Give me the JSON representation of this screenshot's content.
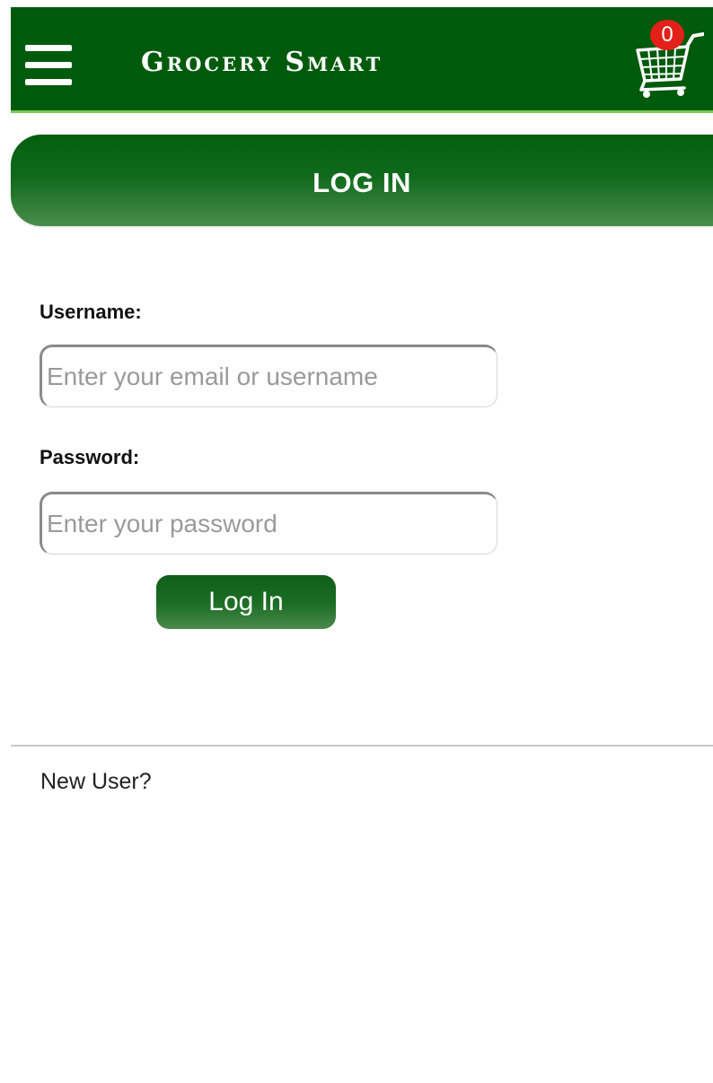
{
  "header": {
    "brand": "Grocery Smart",
    "cart_count": "0",
    "colors": {
      "header_bg": "#005a0c",
      "accent_line": "#7ec850",
      "badge": "#e3211a"
    },
    "icons": {
      "menu": "hamburger-menu-icon",
      "cart": "shopping-cart-icon"
    }
  },
  "page": {
    "title": "LOG IN"
  },
  "form": {
    "username_label": "Username:",
    "username_placeholder": "Enter your email or username",
    "username_value": "",
    "password_label": "Password:",
    "password_placeholder": "Enter your password",
    "password_value": "",
    "submit_label": "Log In"
  },
  "footer": {
    "new_user": "New User?"
  }
}
